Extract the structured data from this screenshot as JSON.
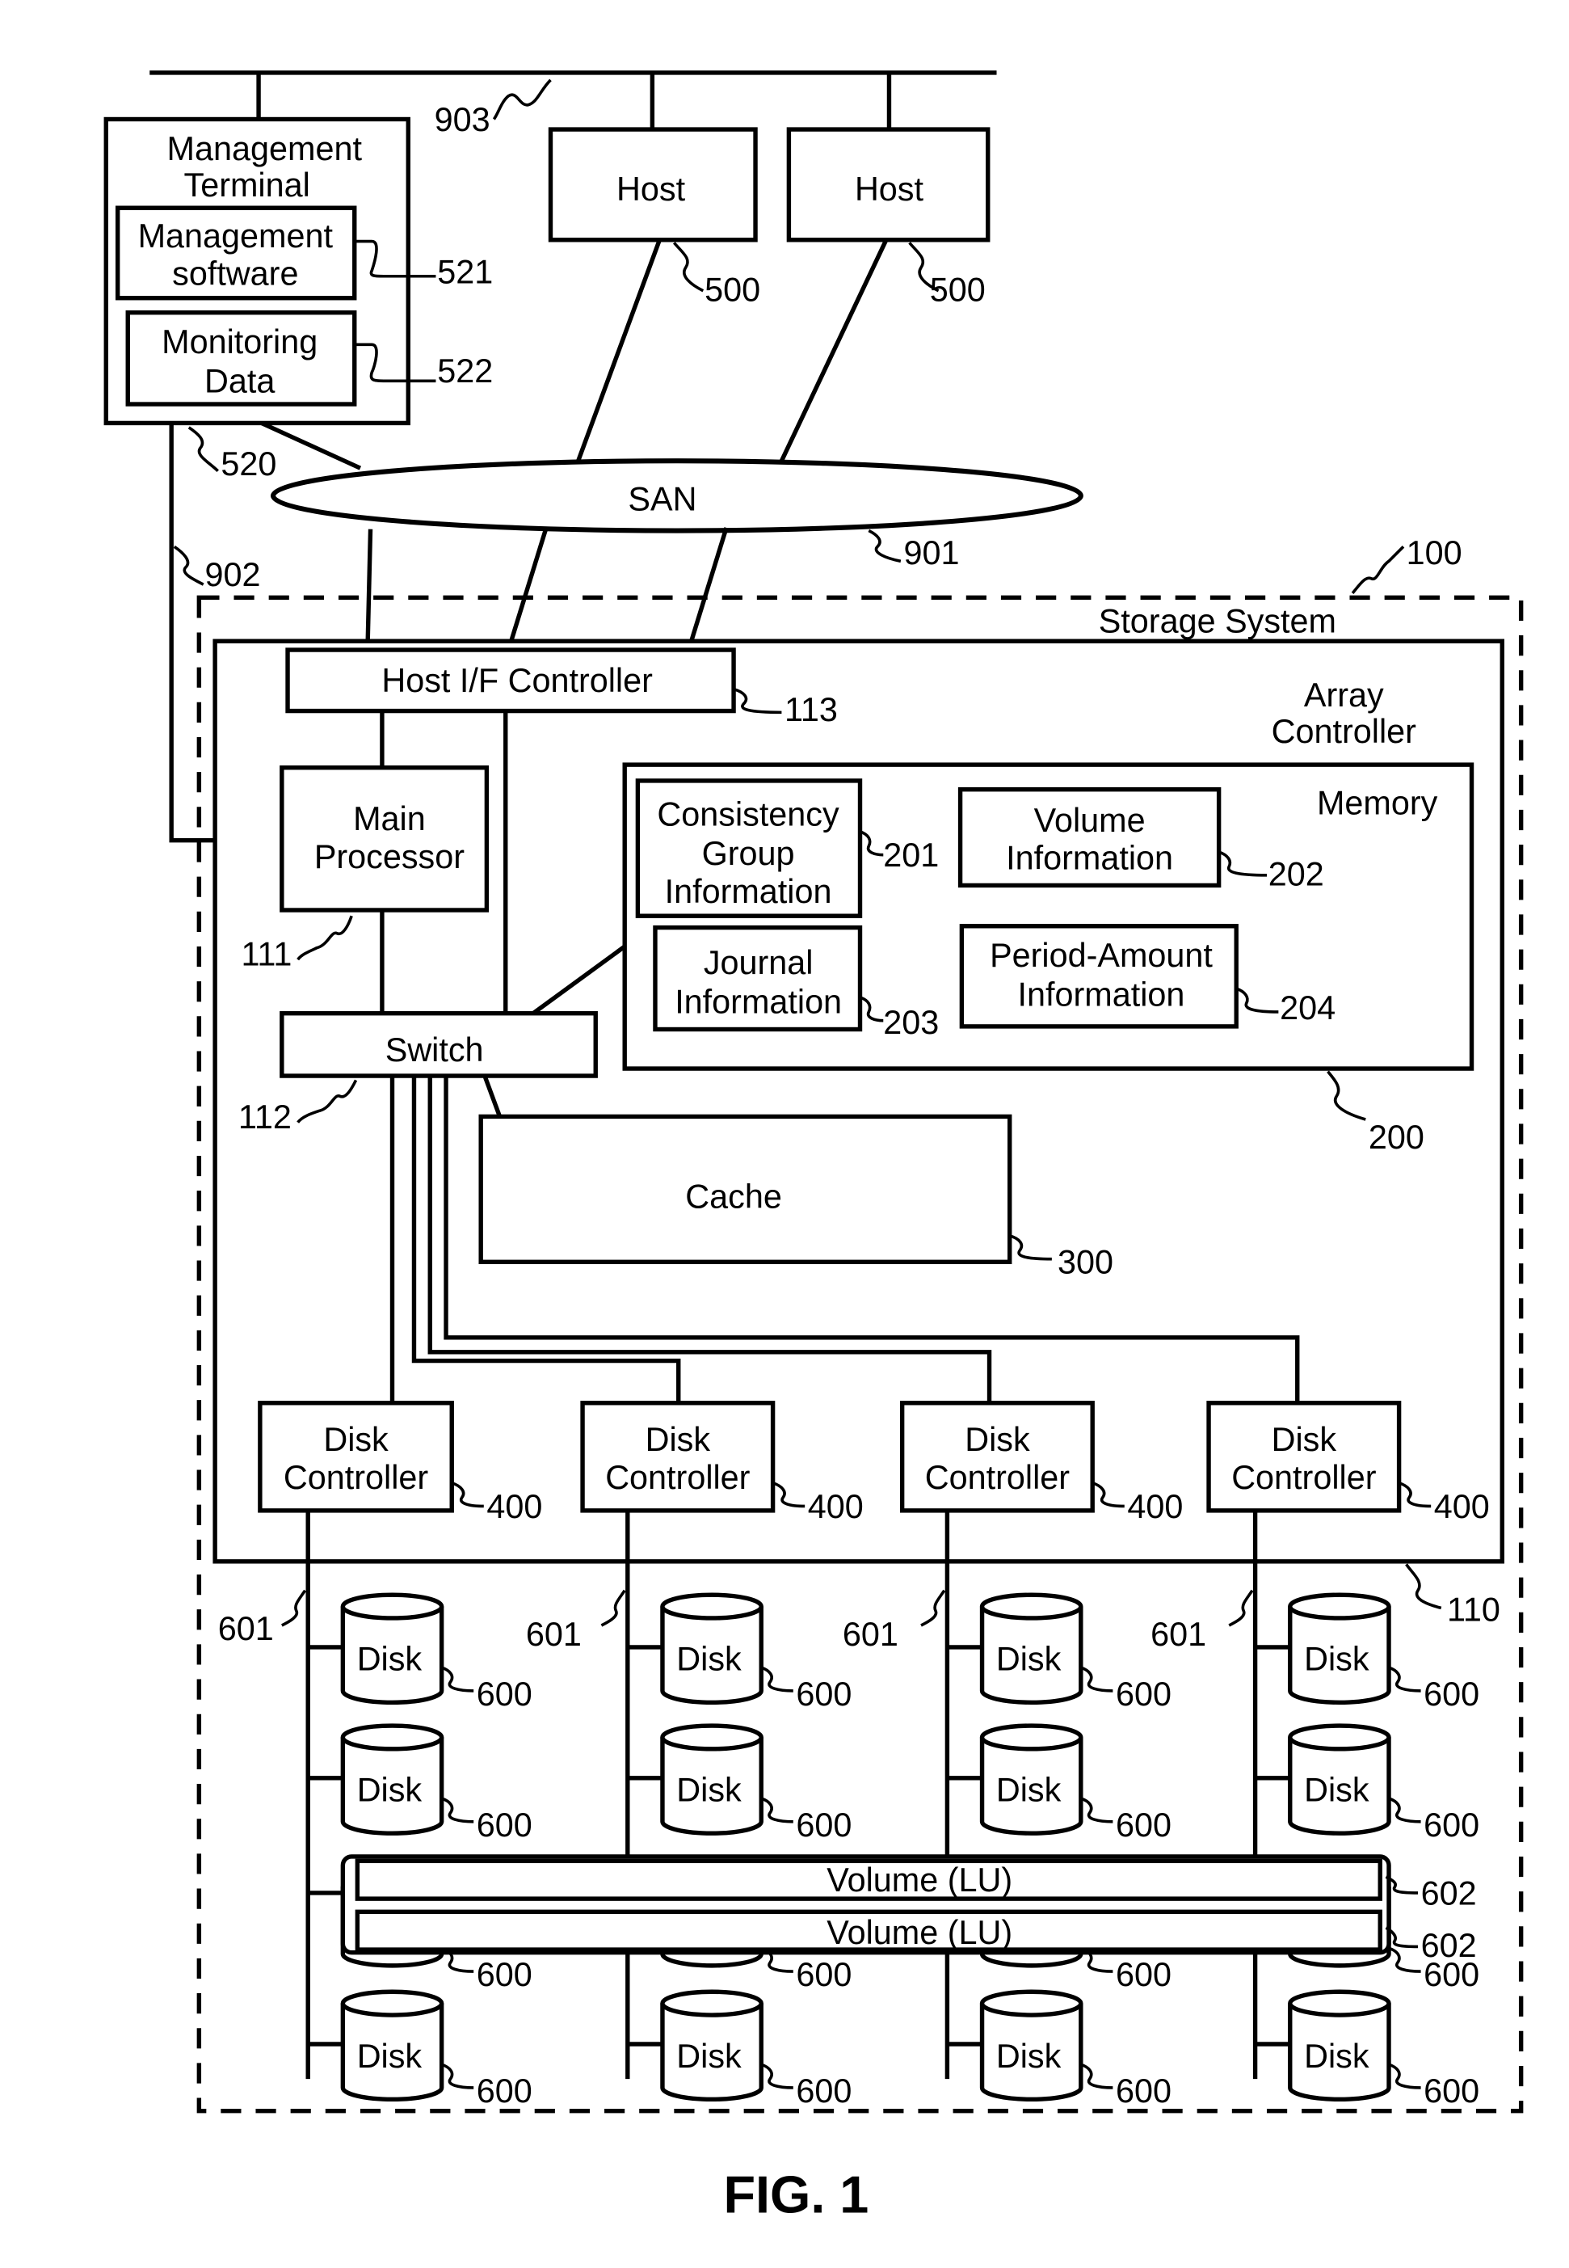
{
  "figure": {
    "caption": "FIG. 1",
    "network_top": {
      "ref": "903"
    },
    "san": {
      "label": "SAN",
      "ref": "901"
    },
    "mgmt_link": {
      "ref": "902"
    },
    "management_terminal": {
      "title_line1": "Management",
      "title_line2": "Terminal",
      "ref": "520",
      "software": {
        "line1": "Management",
        "line2": "software",
        "ref": "521"
      },
      "monitoring": {
        "line1": "Monitoring",
        "line2": "Data",
        "ref": "522"
      }
    },
    "hosts": [
      {
        "label": "Host",
        "ref": "500"
      },
      {
        "label": "Host",
        "ref": "500"
      }
    ],
    "storage_system": {
      "label": "Storage System",
      "ref": "100",
      "array_controller": {
        "line1": "Array",
        "line2": "Controller",
        "ref": "110",
        "host_if": {
          "label": "Host I/F Controller",
          "ref": "113"
        },
        "main_processor": {
          "line1": "Main",
          "line2": "Processor",
          "ref": "111"
        },
        "switch": {
          "label": "Switch",
          "ref": "112"
        },
        "cache": {
          "label": "Cache",
          "ref": "300"
        },
        "memory": {
          "label": "Memory",
          "ref": "200",
          "consistency": {
            "line1": "Consistency",
            "line2": "Group",
            "line3": "Information",
            "ref": "201"
          },
          "volume_info": {
            "line1": "Volume",
            "line2": "Information",
            "ref": "202"
          },
          "journal": {
            "line1": "Journal",
            "line2": "Information",
            "ref": "203"
          },
          "period_amount": {
            "line1": "Period-Amount",
            "line2": "Information",
            "ref": "204"
          }
        },
        "disk_controllers": [
          {
            "line1": "Disk",
            "line2": "Controller",
            "ref": "400"
          },
          {
            "line1": "Disk",
            "line2": "Controller",
            "ref": "400"
          },
          {
            "line1": "Disk",
            "line2": "Controller",
            "ref": "400"
          },
          {
            "line1": "Disk",
            "line2": "Controller",
            "ref": "400"
          }
        ]
      },
      "disk_bus_ref": "601",
      "disk": {
        "label": "Disk",
        "ref": "600"
      },
      "volumes": [
        {
          "label": "Volume (LU)",
          "ref": "602"
        },
        {
          "label": "Volume (LU)",
          "ref": "602"
        }
      ]
    }
  }
}
